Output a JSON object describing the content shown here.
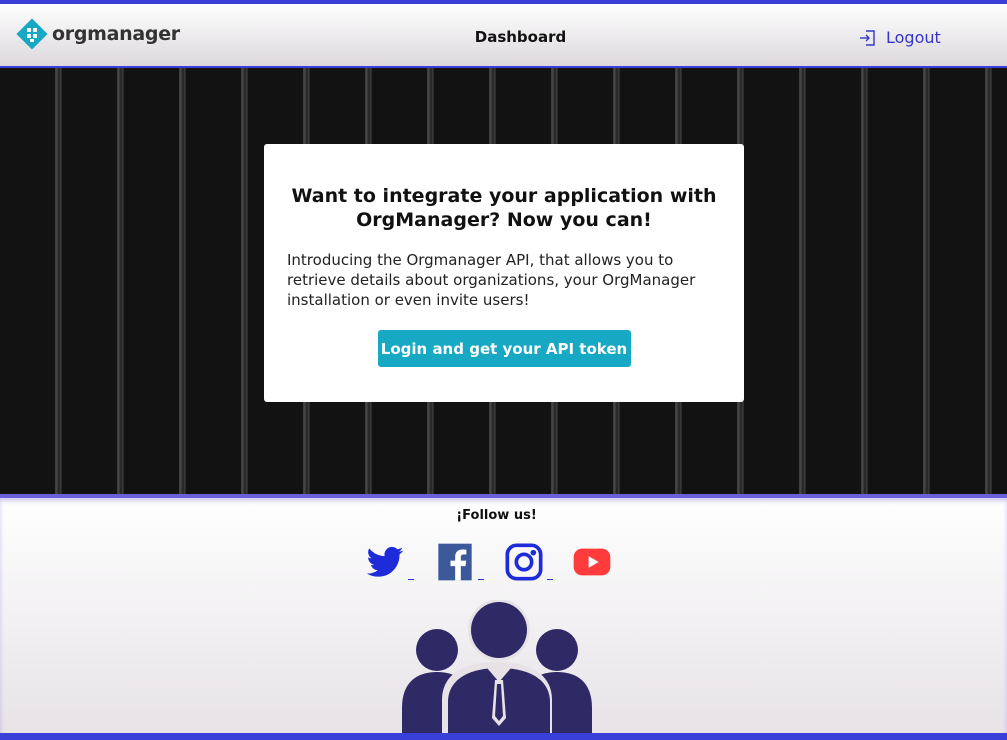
{
  "header": {
    "brand": "orgmanager",
    "nav_title": "Dashboard",
    "logout_label": "Logout"
  },
  "card": {
    "title_line1": "Want to integrate your application with",
    "title_line2": "OrgManager? Now you can!",
    "body": "Introducing the Orgmanager API, that allows you to retrieve details about organizations, your OrgManager installation or even invite users!",
    "cta_label": "Login and get your API token"
  },
  "footer": {
    "follow_label": "¡Follow us!",
    "social": [
      "twitter-icon",
      "facebook-icon",
      "instagram-icon",
      "youtube-icon"
    ]
  },
  "colors": {
    "accent": "#3a3fd8",
    "cta": "#17a8c4",
    "logo": "#17a8c4",
    "team_icon": "#2f2a66"
  }
}
